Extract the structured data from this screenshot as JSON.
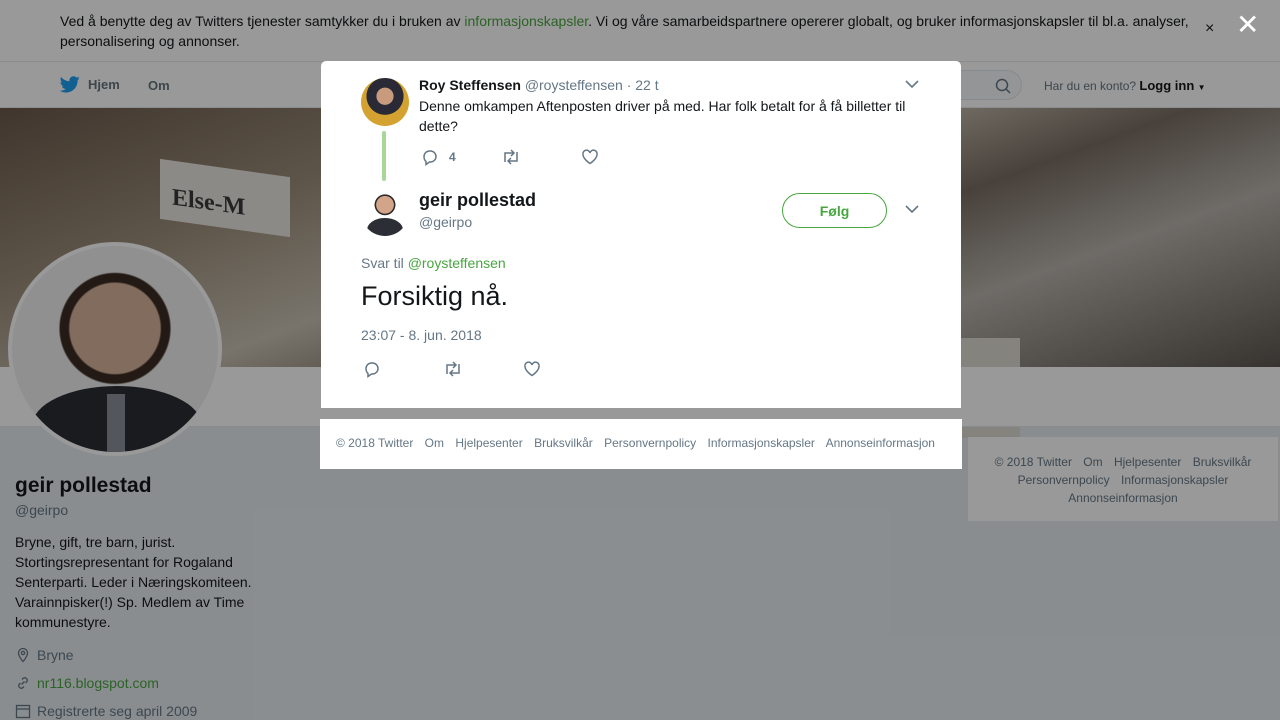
{
  "cookie": {
    "text_before": "Ved å benytte deg av Twitters tjenester samtykker du i bruken av ",
    "link": "informasjonskapsler",
    "text_after": ". Vi og våre samarbeidspartnere opererer globalt, og bruker informasjonskapsler til bl.a. analyser, personalisering og annonser.",
    "close": "×"
  },
  "nav": {
    "home": "Hjem",
    "about": "Om",
    "login_prompt": "Har du en konto?",
    "login": "Logg inn"
  },
  "banner": {
    "sign_text": "Else-M"
  },
  "profile": {
    "name": "geir pollestad",
    "handle": "@geirpo",
    "bio": "Bryne, gift, tre barn, jurist. Stortingsrepresentant for Rogaland Senterparti. Leder i Næringskomiteen. Varainnpisker(!) Sp. Medlem av Time kommunestyre.",
    "location": "Bryne",
    "website": "nr116.blogspot.com",
    "joined": "Registrerte seg april 2009"
  },
  "side_footer": [
    "© 2018 Twitter",
    "Om",
    "Hjelpesenter",
    "Bruksvilkår",
    "Personvernpolicy",
    "Informasjonskapsler",
    "Annonseinformasjon"
  ],
  "overlay_close": "✕",
  "parent_tweet": {
    "name": "Roy Steffensen",
    "handle": "@roysteffensen",
    "time": "· 22 t",
    "text": "Denne omkampen Aftenposten driver på med. Har folk betalt for å få billetter til dette?",
    "reply_count": "4"
  },
  "tweet": {
    "name": "geir pollestad",
    "handle": "@geirpo",
    "follow_label": "Følg",
    "reply_prefix": "Svar til ",
    "reply_to": "@roysteffensen",
    "text": "Forsiktig nå.",
    "timestamp": "23:07 - 8. jun. 2018"
  },
  "modal_footer": [
    "© 2018 Twitter",
    "Om",
    "Hjelpesenter",
    "Bruksvilkår",
    "Personvernpolicy",
    "Informasjonskapsler",
    "Annonseinformasjon"
  ],
  "colors": {
    "accent": "#48a53f",
    "thread_line": "#a6d89c",
    "muted": "#657786",
    "overlay": "rgba(0,0,0,0.4)"
  }
}
